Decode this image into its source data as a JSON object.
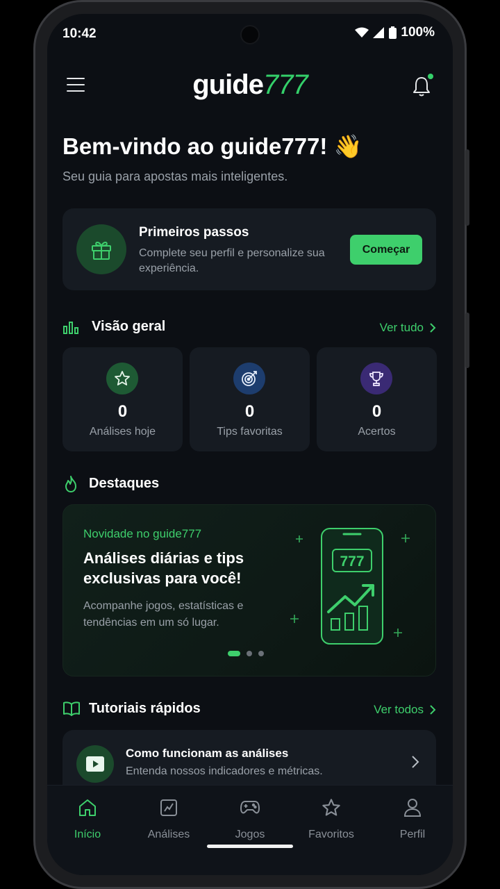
{
  "status_bar": {
    "time": "10:42",
    "battery": "100%"
  },
  "header": {
    "logo_main": "guide",
    "logo_accent": "777"
  },
  "welcome": {
    "title": "Bem-vindo ao guide777! 👋",
    "subtitle": "Seu guia para apostas mais inteligentes."
  },
  "first_steps": {
    "title": "Primeiros passos",
    "description": "Complete seu perfil e personalize sua experiência.",
    "button": "Começar"
  },
  "overview": {
    "title": "Visão geral",
    "link": "Ver tudo",
    "stats": [
      {
        "value": "0",
        "label": "Análises hoje",
        "icon": "star-icon",
        "color": "#1e5a34"
      },
      {
        "value": "0",
        "label": "Tips favoritas",
        "icon": "target-icon",
        "color": "#1d3d6e"
      },
      {
        "value": "0",
        "label": "Acertos",
        "icon": "trophy-icon",
        "color": "#3a2a74"
      }
    ]
  },
  "highlights": {
    "title": "Destaques",
    "banner": {
      "kicker": "Novidade no guide777",
      "headline": "Análises diárias e tips exclusivas para você!",
      "body": "Acompanhe jogos, estatísticas e tendências em um só lugar.",
      "art_text": "777",
      "slides_total": 3,
      "active_slide": 1
    }
  },
  "tutorials": {
    "title": "Tutoriais rápidos",
    "link": "Ver todos",
    "items": [
      {
        "title": "Como funcionam as análises",
        "description": "Entenda nossos indicadores e métricas."
      }
    ]
  },
  "bottom_nav": {
    "items": [
      {
        "label": "Início",
        "icon": "home-icon",
        "active": true
      },
      {
        "label": "Análises",
        "icon": "chart-icon",
        "active": false
      },
      {
        "label": "Jogos",
        "icon": "gamepad-icon",
        "active": false
      },
      {
        "label": "Favoritos",
        "icon": "star-icon",
        "active": false
      },
      {
        "label": "Perfil",
        "icon": "user-icon",
        "active": false
      }
    ]
  },
  "colors": {
    "accent": "#3ecf6c",
    "background": "#0c0f14",
    "card": "#161b22",
    "muted_text": "#9aa1a9"
  }
}
